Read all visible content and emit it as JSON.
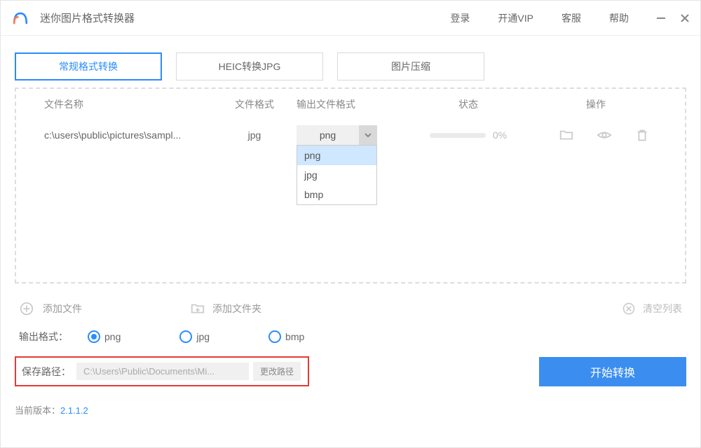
{
  "header": {
    "app_title": "迷你图片格式转换器",
    "nav": {
      "login": "登录",
      "vip": "开通VIP",
      "support": "客服",
      "help": "帮助"
    }
  },
  "tabs": {
    "normal": "常规格式转换",
    "heic": "HEIC转换JPG",
    "compress": "图片压缩"
  },
  "table": {
    "headers": {
      "name": "文件名称",
      "format": "文件格式",
      "output": "输出文件格式",
      "status": "状态",
      "ops": "操作"
    },
    "row": {
      "name": "c:\\users\\public\\pictures\\sampl...",
      "format": "jpg",
      "output_selected": "png",
      "progress_pct": "0%"
    },
    "dropdown": {
      "opt1": "png",
      "opt2": "jpg",
      "opt3": "bmp"
    }
  },
  "toolbar": {
    "add_file": "添加文件",
    "add_folder": "添加文件夹",
    "clear_list": "清空列表"
  },
  "radio": {
    "label": "输出格式：",
    "png": "png",
    "jpg": "jpg",
    "bmp": "bmp",
    "selected": "png"
  },
  "path": {
    "label": "保存路径：",
    "value": "C:\\Users\\Public\\Documents\\Mi...",
    "change": "更改路径"
  },
  "start_button": "开始转换",
  "footer": {
    "label": "当前版本：",
    "version": "2.1.1.2"
  },
  "colors": {
    "primary": "#2a8cff",
    "button": "#3b8ef0",
    "highlight_border": "#e53935"
  }
}
